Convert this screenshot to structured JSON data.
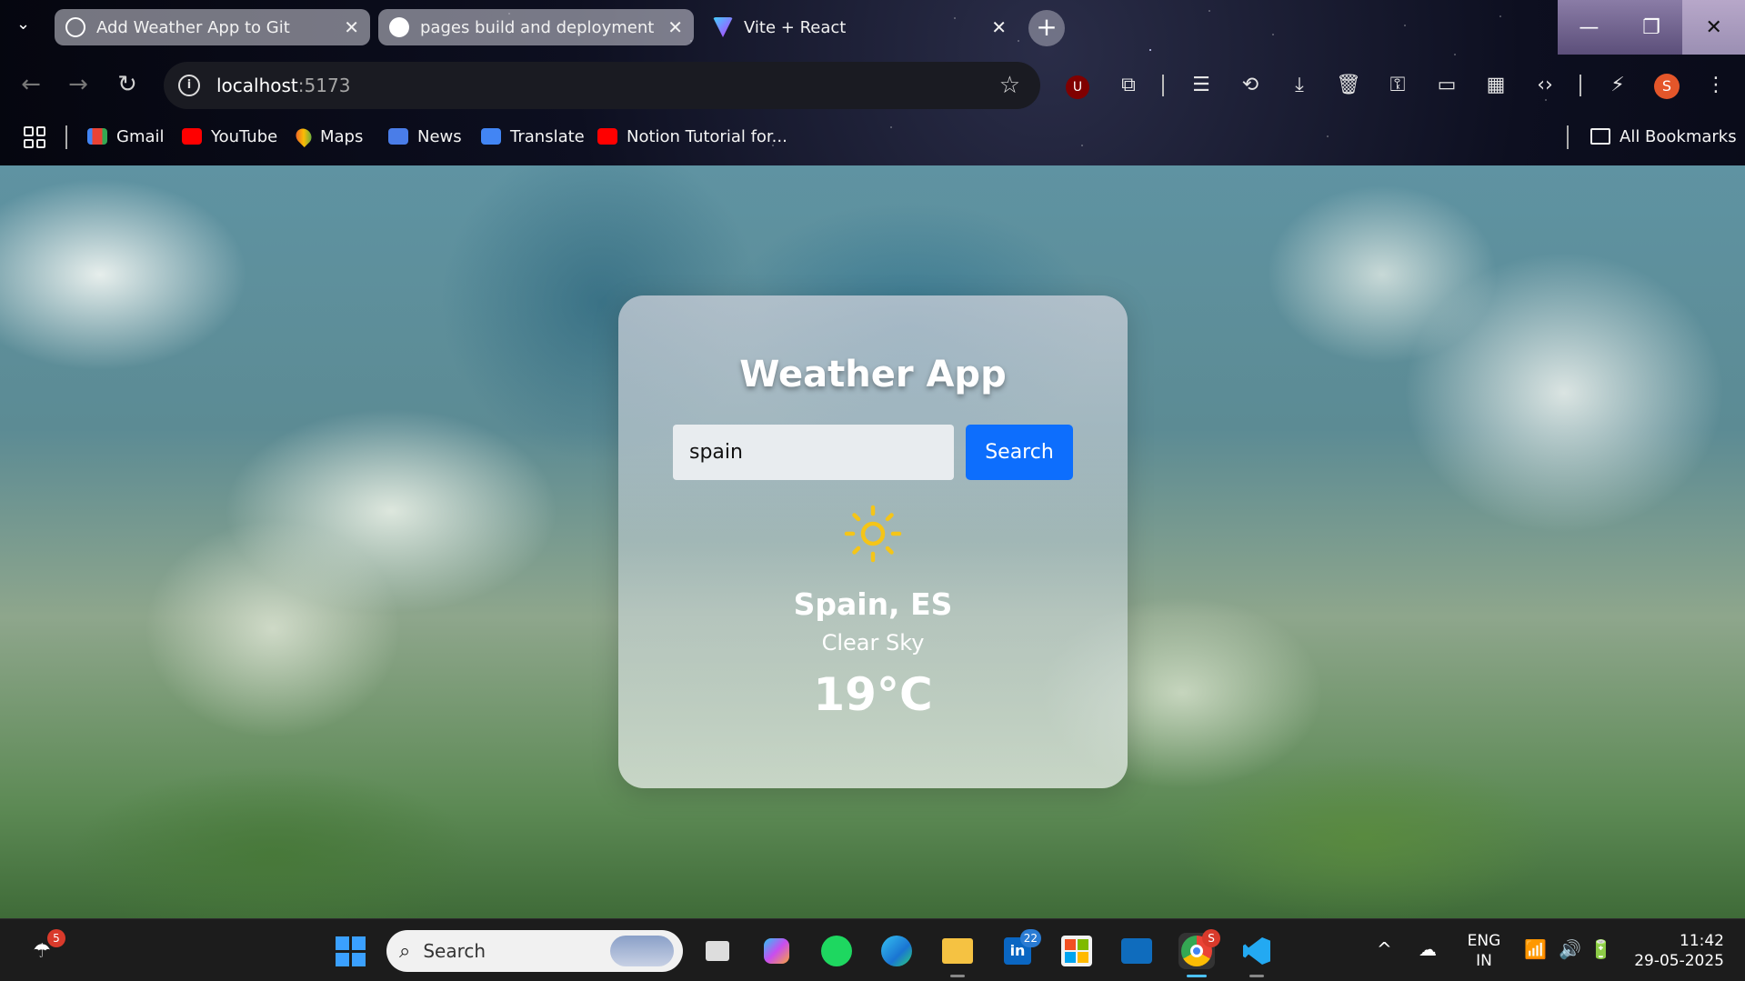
{
  "browser": {
    "tabs": [
      {
        "title": "Add Weather App to Git",
        "state": "inactive"
      },
      {
        "title": "pages build and deployment",
        "state": "inactive"
      },
      {
        "title": "Vite + React",
        "state": "active"
      }
    ],
    "address": {
      "host": "localhost",
      "port": ":5173"
    },
    "profile_initial": "S",
    "bookmarks": [
      "Gmail",
      "YouTube",
      "Maps",
      "News",
      "Translate",
      "Notion Tutorial for..."
    ],
    "all_bookmarks_label": "All Bookmarks"
  },
  "weather_app": {
    "title": "Weather App",
    "search": {
      "value": "spain",
      "button_label": "Search"
    },
    "result": {
      "icon": "sun-icon",
      "location": "Spain, ES",
      "condition": "Clear Sky",
      "temperature": "19°C"
    }
  },
  "taskbar": {
    "weather_badge": "5",
    "search_placeholder": "Search",
    "linkedin_badge": "22",
    "chrome_badge": "S",
    "language": {
      "line1": "ENG",
      "line2": "IN"
    },
    "clock": {
      "time": "11:42",
      "date": "29-05-2025"
    }
  },
  "colors": {
    "accent": "#0d6efd",
    "sun": "#f5c518",
    "profile": "#e4562a"
  }
}
